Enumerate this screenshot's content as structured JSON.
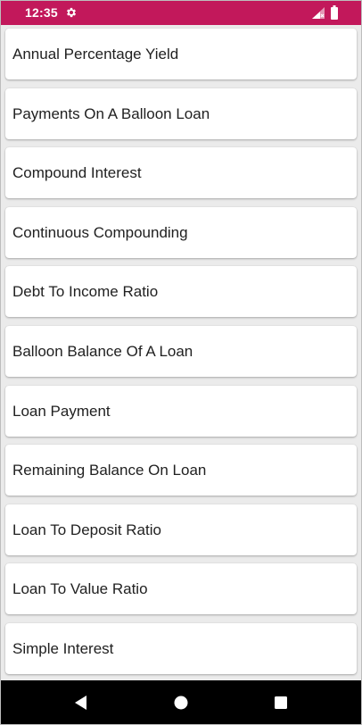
{
  "status_bar": {
    "time": "12:35",
    "background_color": "#c2185b",
    "icons": [
      "gear-icon",
      "signal-icon",
      "battery-icon"
    ]
  },
  "list": {
    "items": [
      {
        "label": "Annual Percentage Yield"
      },
      {
        "label": "Payments On A Balloon Loan"
      },
      {
        "label": "Compound Interest"
      },
      {
        "label": "Continuous Compounding"
      },
      {
        "label": "Debt To Income Ratio"
      },
      {
        "label": "Balloon Balance Of A Loan"
      },
      {
        "label": "Loan Payment"
      },
      {
        "label": "Remaining Balance On Loan"
      },
      {
        "label": "Loan To Deposit Ratio"
      },
      {
        "label": "Loan To Value Ratio"
      },
      {
        "label": "Simple Interest"
      }
    ]
  },
  "nav_bar": {
    "icons": [
      "back-icon",
      "home-icon",
      "recents-icon"
    ]
  }
}
